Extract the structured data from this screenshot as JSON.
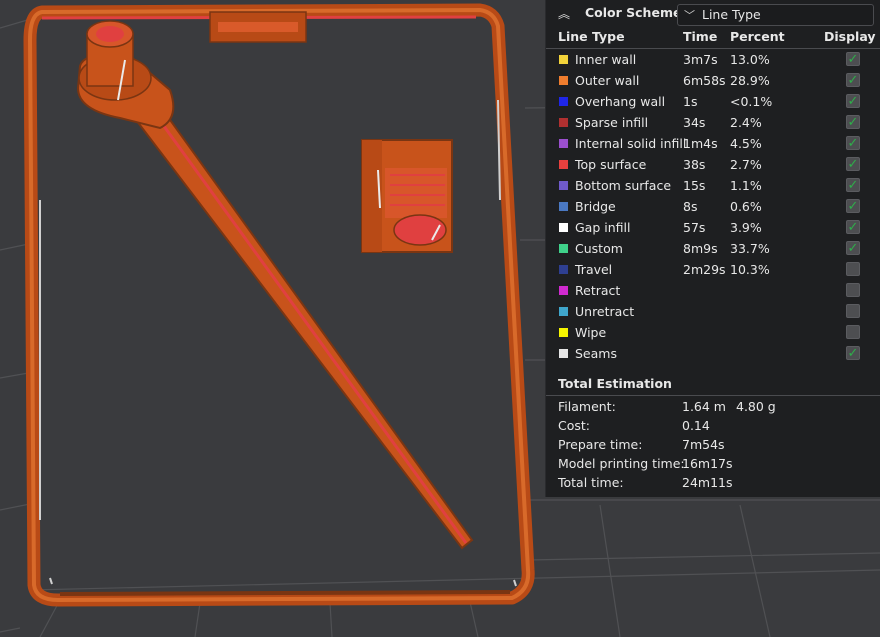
{
  "panel": {
    "title": "Color Scheme",
    "scheme_value": "Line Type",
    "headers": {
      "type": "Line Type",
      "time": "Time",
      "percent": "Percent",
      "display": "Display"
    },
    "rows": [
      {
        "label": "Inner wall",
        "time": "3m7s",
        "percent": "13.0%",
        "color": "#f2d33a",
        "display": true
      },
      {
        "label": "Outer wall",
        "time": "6m58s",
        "percent": "28.9%",
        "color": "#ef7d2e",
        "display": true
      },
      {
        "label": "Overhang wall",
        "time": "1s",
        "percent": "<0.1%",
        "color": "#1f26e8",
        "display": true
      },
      {
        "label": "Sparse infill",
        "time": "34s",
        "percent": "2.4%",
        "color": "#b03030",
        "display": true
      },
      {
        "label": "Internal solid infill",
        "time": "1m4s",
        "percent": "4.5%",
        "color": "#9b4fce",
        "display": true
      },
      {
        "label": "Top surface",
        "time": "38s",
        "percent": "2.7%",
        "color": "#e8403e",
        "display": true
      },
      {
        "label": "Bottom surface",
        "time": "15s",
        "percent": "1.1%",
        "color": "#6f5acb",
        "display": true
      },
      {
        "label": "Bridge",
        "time": "8s",
        "percent": "0.6%",
        "color": "#4a78c2",
        "display": true
      },
      {
        "label": "Gap infill",
        "time": "57s",
        "percent": "3.9%",
        "color": "#ffffff",
        "display": true
      },
      {
        "label": "Custom",
        "time": "8m9s",
        "percent": "33.7%",
        "color": "#3fd18a",
        "display": true
      },
      {
        "label": "Travel",
        "time": "2m29s",
        "percent": "10.3%",
        "color": "#2e3f91",
        "display": false
      },
      {
        "label": "Retract",
        "time": "",
        "percent": "",
        "color": "#d02ad0",
        "display": false
      },
      {
        "label": "Unretract",
        "time": "",
        "percent": "",
        "color": "#3fa6cc",
        "display": false
      },
      {
        "label": "Wipe",
        "time": "",
        "percent": "",
        "color": "#f5f500",
        "display": false
      },
      {
        "label": "Seams",
        "time": "",
        "percent": "",
        "color": "#e6e6e6",
        "display": true
      }
    ],
    "estimation": {
      "title": "Total Estimation",
      "items": [
        {
          "label": "Filament:",
          "value": "1.64 m",
          "value2": "4.80 g"
        },
        {
          "label": "Cost:",
          "value": "0.14",
          "value2": ""
        },
        {
          "label": "Prepare time:",
          "value": "7m54s",
          "value2": ""
        },
        {
          "label": "Model printing time:",
          "value": "16m17s",
          "value2": ""
        },
        {
          "label": "Total time:",
          "value": "24m11s",
          "value2": ""
        }
      ]
    }
  },
  "colors": {
    "background": "#3a3b3e",
    "grid": "#5a5b5e",
    "model": "#c8531b",
    "model_dark": "#7a3512",
    "check": "#2fae4a"
  }
}
